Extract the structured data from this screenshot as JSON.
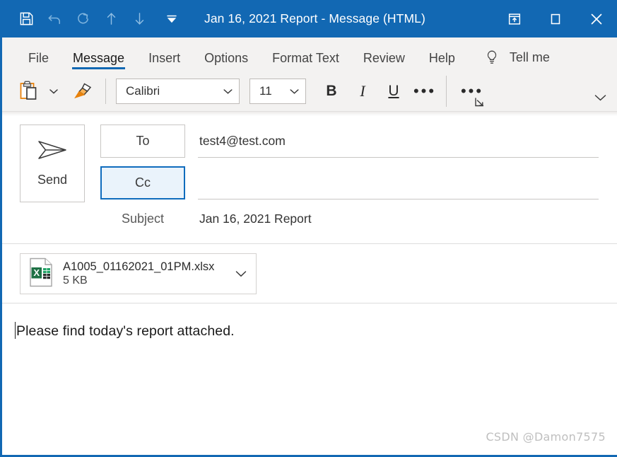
{
  "window": {
    "title": "Jan 16, 2021 Report  -  Message (HTML)",
    "accent_color": "#1268B3",
    "ribbon_bg": "#F3F2F1"
  },
  "quick_access": {
    "items": [
      {
        "name": "save-icon",
        "label": "Save"
      },
      {
        "name": "undo-icon",
        "label": "Undo"
      },
      {
        "name": "redo-icon",
        "label": "Redo"
      },
      {
        "name": "previous-item-icon",
        "label": "Previous Item"
      },
      {
        "name": "next-item-icon",
        "label": "Next Item"
      },
      {
        "name": "customize-quick-access-toolbar-icon",
        "label": "Customize Quick Access Toolbar"
      }
    ]
  },
  "window_controls": {
    "restore_down_label": "Restore Down",
    "maximize_label": "Maximize",
    "close_label": "Close"
  },
  "ribbon": {
    "tabs": [
      {
        "label": "File",
        "active": false
      },
      {
        "label": "Message",
        "active": true
      },
      {
        "label": "Insert",
        "active": false
      },
      {
        "label": "Options",
        "active": false
      },
      {
        "label": "Format Text",
        "active": false
      },
      {
        "label": "Review",
        "active": false
      },
      {
        "label": "Help",
        "active": false
      }
    ],
    "tell_me": "Tell me",
    "clipboard": {
      "paste_label": "Paste",
      "paste_dropdown_label": "Paste Options",
      "format_painter_label": "Format Painter"
    },
    "font": {
      "family_value": "Calibri",
      "size_value": "11",
      "bold_label": "B",
      "italic_label": "I",
      "underline_label": "U",
      "more_font_options_label": "•••",
      "dialog_launcher_label": "Font Dialog Box Launcher"
    },
    "overflow_label": "•••",
    "collapse_label": "Collapse the Ribbon"
  },
  "compose": {
    "send_label": "Send",
    "to_label": "To",
    "to_value": "test4@test.com",
    "cc_label": "Cc",
    "cc_value": "",
    "subject_label": "Subject",
    "subject_value": "Jan 16, 2021 Report"
  },
  "attachment": {
    "file_name": "A1005_01162021_01PM.xlsx",
    "file_size": "5 KB",
    "file_type_icon": "excel-file-icon",
    "excel_letter": "X",
    "icon_color": "#1E7145",
    "dropdown_label": "Attachment Options"
  },
  "message_body": {
    "text": "Please find today's report attached."
  },
  "watermark": {
    "text": "CSDN @Damon7575"
  }
}
